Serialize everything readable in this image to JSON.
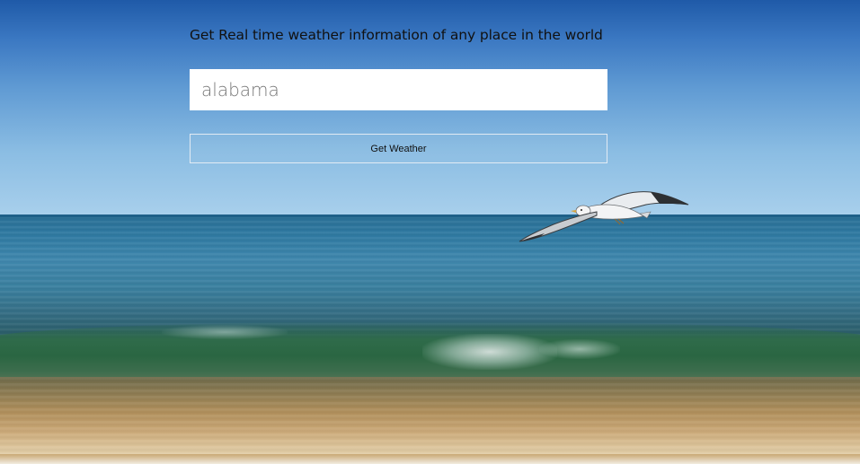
{
  "page": {
    "tagline": "Get Real time weather information of any place in the world"
  },
  "search": {
    "value": "alabama",
    "placeholder": ""
  },
  "actions": {
    "get_weather_label": "Get Weather"
  },
  "colors": {
    "sky_top": "#1f5aa8",
    "sky_bottom": "#a9d0ec",
    "sea": "#2f7aa2",
    "wave": "#2f6b4a",
    "sand": "#caa877",
    "input_background": "#ffffff",
    "text": "#111111"
  },
  "background": {
    "scene": "beach-with-seagull"
  }
}
